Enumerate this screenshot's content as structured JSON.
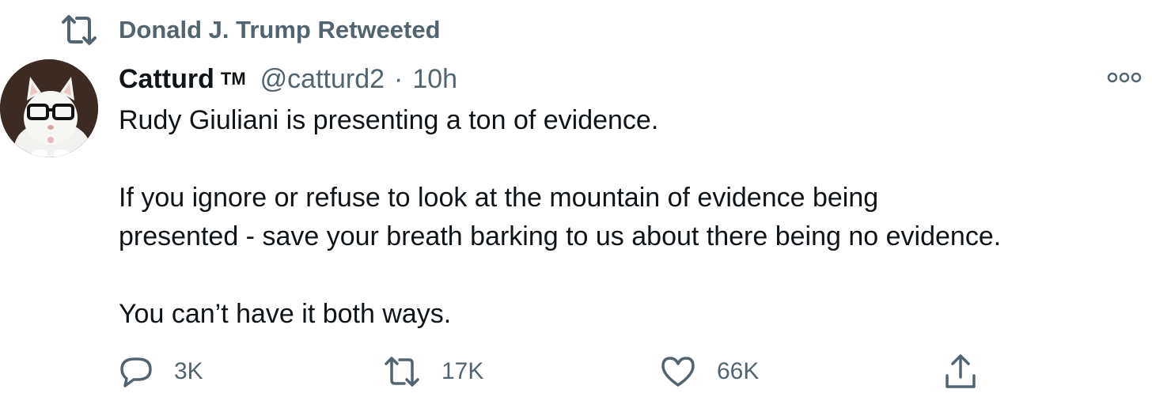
{
  "retweet_context": {
    "label": "Donald J. Trump Retweeted",
    "icon": "retweet-icon"
  },
  "tweet": {
    "display_name": "Catturd",
    "badge": "TM",
    "handle": "@catturd2",
    "separator": "·",
    "time": "10h",
    "avatar_icon": "cat-with-glasses-avatar",
    "more_icon": "more-icon",
    "text": {
      "line1": "Rudy Giuliani is presenting a ton of evidence.",
      "line2": "If you ignore or refuse to look at the mountain of evidence being",
      "line3": "presented - save your breath barking to us about there being no evidence.",
      "line4": "You can’t have it both ways."
    }
  },
  "actions": {
    "reply": {
      "count": "3K",
      "icon": "reply-icon"
    },
    "retweet": {
      "count": "17K",
      "icon": "retweet-icon"
    },
    "like": {
      "count": "66K",
      "icon": "heart-icon"
    },
    "share": {
      "icon": "share-icon"
    }
  },
  "colors": {
    "text_primary": "#0f1419",
    "text_secondary": "#536471",
    "background": "#ffffff"
  }
}
